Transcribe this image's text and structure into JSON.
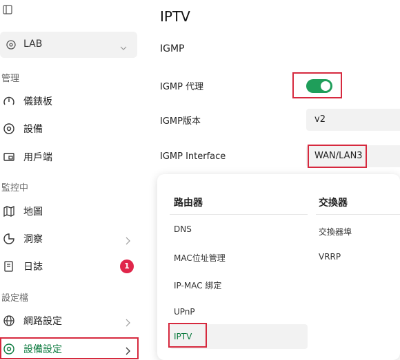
{
  "sidebar": {
    "site_name": "LAB",
    "sections": {
      "manage": "管理",
      "monitor": "監控中",
      "config": "設定檔"
    },
    "items": [
      {
        "label": "儀錶板",
        "icon": "gauge-icon"
      },
      {
        "label": "設備",
        "icon": "device-icon"
      },
      {
        "label": "用戶端",
        "icon": "client-icon"
      },
      {
        "label": "地圖",
        "icon": "map-icon"
      },
      {
        "label": "洞察",
        "icon": "insight-icon"
      },
      {
        "label": "日誌",
        "icon": "log-icon",
        "badge": "1"
      },
      {
        "label": "網路設定",
        "icon": "globe-icon"
      },
      {
        "label": "設備設定",
        "icon": "device-settings-icon",
        "active": true
      }
    ]
  },
  "main": {
    "title": "IPTV",
    "section": "IGMP",
    "igmp_proxy": {
      "label": "IGMP 代理",
      "enabled": true
    },
    "igmp_version": {
      "label": "IGMP版本",
      "value": "v2"
    },
    "igmp_interface": {
      "label": "IGMP Interface",
      "value": "WAN/LAN3"
    }
  },
  "menu": {
    "router_heading": "路由器",
    "switch_heading": "交換器",
    "router_items": [
      "DNS",
      "MAC位址管理",
      "IP-MAC 綁定",
      "UPnP",
      "IPTV"
    ],
    "switch_items": [
      "交換器埠",
      "VRRP"
    ]
  },
  "colors": {
    "accent_green": "#1f9e5a",
    "highlight_red": "#d6293e",
    "badge_red": "#e0264a"
  }
}
